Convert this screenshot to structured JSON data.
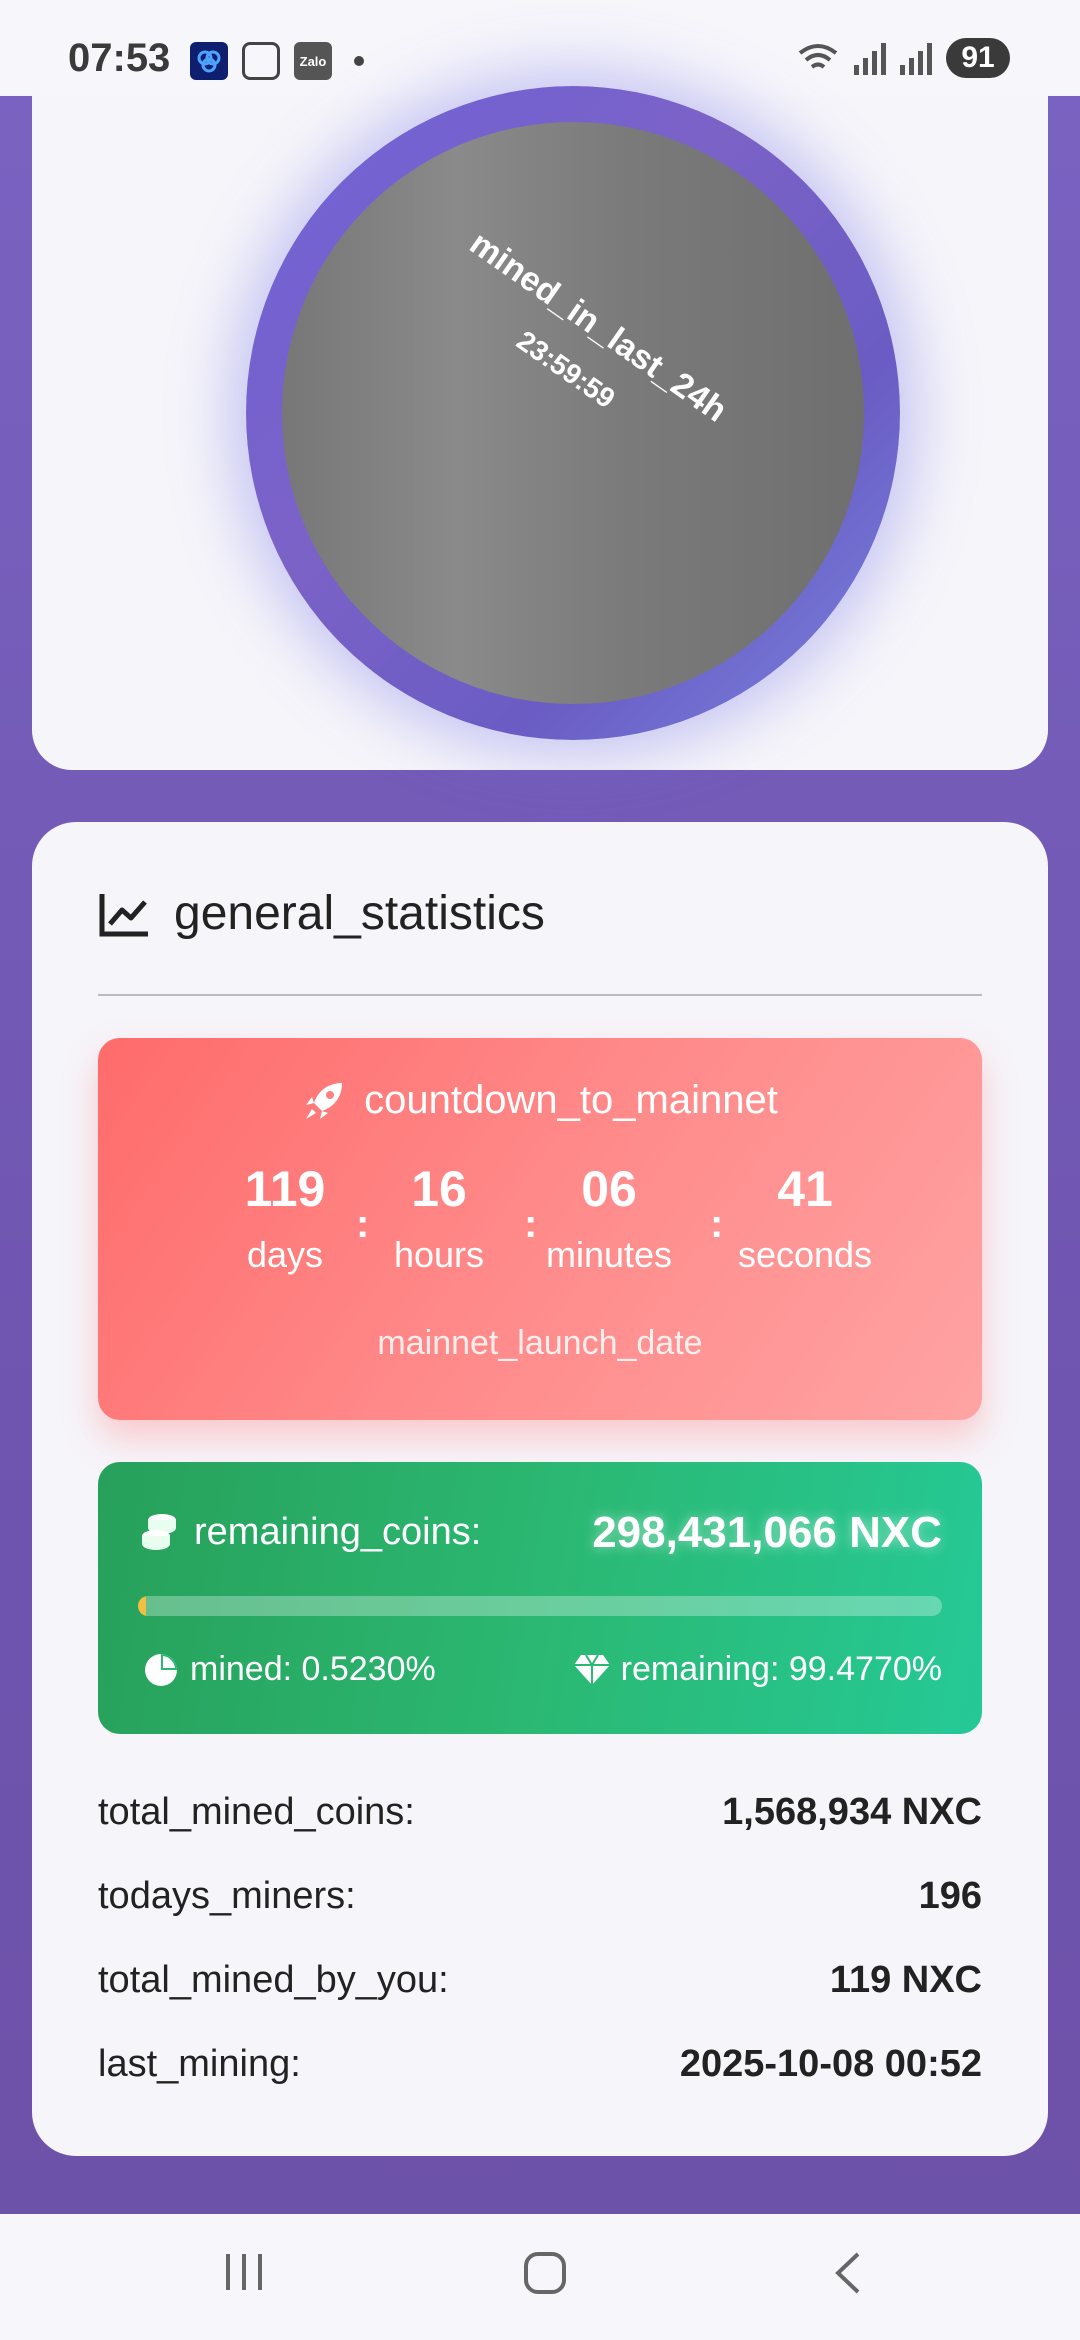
{
  "status_bar": {
    "time": "07:53",
    "battery": "91",
    "left_icons": [
      "app-icon",
      "screenshot-icon",
      "zalo-icon"
    ],
    "zalo_label": "Zalo"
  },
  "mining": {
    "label": "mined_in_last_24h",
    "timer": "23:59:59"
  },
  "stats": {
    "title": "general_statistics",
    "countdown": {
      "title": "countdown_to_mainnet",
      "units": [
        {
          "value": "119",
          "label": "days"
        },
        {
          "value": "16",
          "label": "hours"
        },
        {
          "value": "06",
          "label": "minutes"
        },
        {
          "value": "41",
          "label": "seconds"
        }
      ],
      "launch_date_label": "mainnet_launch_date"
    },
    "remaining": {
      "label": "remaining_coins:",
      "value": "298,431,066 NXC",
      "mined_percent": 0.523,
      "mined_text": "mined: 0.5230%",
      "remaining_text": "remaining: 99.4770%"
    },
    "rows": [
      {
        "label": "total_mined_coins:",
        "value": "1,568,934 NXC"
      },
      {
        "label": "todays_miners:",
        "value": "196"
      },
      {
        "label": "total_mined_by_you:",
        "value": "119 NXC"
      },
      {
        "label": "last_mining:",
        "value": "2025-10-08 00:52"
      }
    ]
  },
  "colors": {
    "background": "#7a63c2",
    "countdown": "#ff6b6b",
    "remaining": "#2bb872"
  }
}
